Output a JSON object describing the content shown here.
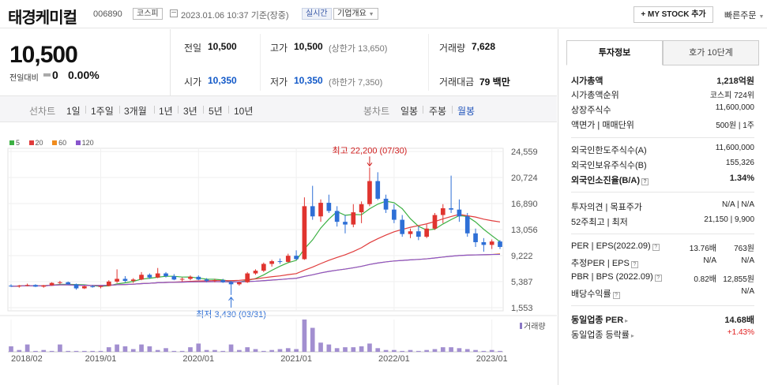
{
  "header": {
    "name": "태경케미컬",
    "code": "006890",
    "market": "코스피",
    "datetime": "2023.01.06 10:37 기준(장중)",
    "realtime": "실시간",
    "corp_info": "기업개요",
    "my_stock": "+ MY STOCK 추가",
    "quick_order": "빠른주문"
  },
  "price": {
    "current": "10,500",
    "change_label": "전일대비",
    "change_value": "0",
    "change_pct": "0.00%"
  },
  "stats": {
    "prev_close_label": "전일",
    "prev_close": "10,500",
    "high_label": "고가",
    "high": "10,500",
    "upper_limit": "(상한가 13,650)",
    "volume_label": "거래량",
    "volume": "7,628",
    "open_label": "시가",
    "open": "10,350",
    "low_label": "저가",
    "low": "10,350",
    "lower_limit": "(하한가 7,350)",
    "amount_label": "거래대금",
    "amount": "79 백만"
  },
  "period_bar": {
    "line_label": "선차트",
    "line_options": [
      "1일",
      "1주일",
      "3개월",
      "1년",
      "3년",
      "5년",
      "10년"
    ],
    "candle_label": "봉차트",
    "candle_options": [
      "일봉",
      "주봉",
      "월봉"
    ],
    "active_candle": "월봉"
  },
  "chart_data": {
    "type": "candlestick",
    "title": "",
    "period": "monthly",
    "moving_averages": [
      {
        "name": "5",
        "color": "#3cb043"
      },
      {
        "name": "20",
        "color": "#e03c3c"
      },
      {
        "name": "60",
        "color": "#f08c1e"
      },
      {
        "name": "120",
        "color": "#8855cc"
      }
    ],
    "y_ticks": [
      24559,
      20724,
      16890,
      13056,
      9222,
      5387,
      1553
    ],
    "y_tick_labels": [
      "24,559",
      "20,724",
      "16,890",
      "13,056",
      "9,222",
      "5,387",
      "1,553"
    ],
    "ylim": [
      1553,
      24559
    ],
    "x_tick_labels": [
      "2018/02",
      "2019/01",
      "2020/01",
      "2021/01",
      "2022/01",
      "2023/01"
    ],
    "high_annotation": "최고 22,200 (07/30)",
    "low_annotation": "최저 3,430 (03/31)",
    "volume_label": "거래량",
    "candles": [
      [
        4800,
        5000,
        4600,
        4700
      ],
      [
        4700,
        4900,
        4500,
        4800
      ],
      [
        4800,
        5100,
        4700,
        4900
      ],
      [
        4900,
        5000,
        4600,
        4650
      ],
      [
        4650,
        4900,
        4500,
        4850
      ],
      [
        4850,
        5300,
        4800,
        5200
      ],
      [
        5200,
        5500,
        5000,
        5300
      ],
      [
        5300,
        5400,
        4900,
        5000
      ],
      [
        5000,
        5100,
        4200,
        4400
      ],
      [
        4400,
        4800,
        4300,
        4700
      ],
      [
        4700,
        4900,
        4500,
        4600
      ],
      [
        4600,
        4800,
        4400,
        4750
      ],
      [
        4750,
        5600,
        4700,
        5400
      ],
      [
        5400,
        7200,
        5200,
        5800
      ],
      [
        5800,
        6200,
        5300,
        5500
      ],
      [
        5500,
        5900,
        5200,
        5700
      ],
      [
        5700,
        6800,
        5600,
        6400
      ],
      [
        6400,
        6600,
        5800,
        6000
      ],
      [
        6000,
        7400,
        5900,
        6600
      ],
      [
        6600,
        6800,
        6000,
        6200
      ],
      [
        6200,
        6500,
        5600,
        5700
      ],
      [
        5700,
        6000,
        5400,
        5800
      ],
      [
        5800,
        6300,
        5600,
        6100
      ],
      [
        6100,
        6300,
        5600,
        5700
      ],
      [
        5700,
        5900,
        5300,
        5500
      ],
      [
        5500,
        5800,
        5300,
        5600
      ],
      [
        5600,
        5800,
        5200,
        5300
      ],
      [
        5300,
        5500,
        3430,
        5000
      ],
      [
        5000,
        5400,
        4800,
        5300
      ],
      [
        5300,
        6800,
        5200,
        6600
      ],
      [
        6600,
        7200,
        6400,
        7000
      ],
      [
        7000,
        8200,
        6800,
        8000
      ],
      [
        8000,
        8600,
        7600,
        8400
      ],
      [
        8400,
        8800,
        8000,
        8300
      ],
      [
        8300,
        9500,
        8200,
        9200
      ],
      [
        9200,
        10000,
        8600,
        8700
      ],
      [
        8700,
        17800,
        8600,
        16500
      ],
      [
        16500,
        19500,
        14500,
        15000
      ],
      [
        15000,
        17500,
        14200,
        17000
      ],
      [
        17000,
        18200,
        15500,
        15800
      ],
      [
        15800,
        16500,
        13500,
        14200
      ],
      [
        14200,
        15200,
        12500,
        13800
      ],
      [
        13800,
        16800,
        13400,
        15600
      ],
      [
        15600,
        17200,
        14000,
        16800
      ],
      [
        16800,
        22200,
        16500,
        20200
      ],
      [
        20200,
        21500,
        17400,
        17600
      ],
      [
        17600,
        18200,
        15500,
        16000
      ],
      [
        16000,
        16800,
        14000,
        14500
      ],
      [
        14500,
        15200,
        12000,
        12400
      ],
      [
        12400,
        13200,
        11800,
        12800
      ],
      [
        12800,
        13500,
        11500,
        12000
      ],
      [
        12000,
        13800,
        11800,
        13200
      ],
      [
        13200,
        15500,
        13000,
        15200
      ],
      [
        15200,
        16800,
        14000,
        16200
      ],
      [
        16200,
        21000,
        15500,
        16000
      ],
      [
        16000,
        17500,
        14200,
        15000
      ],
      [
        15000,
        15500,
        12000,
        12500
      ],
      [
        12500,
        13200,
        10500,
        11200
      ],
      [
        11200,
        11800,
        9800,
        10800
      ],
      [
        10800,
        11600,
        10200,
        11300
      ],
      [
        11300,
        11500,
        10200,
        10500
      ]
    ],
    "volumes": [
      6,
      2,
      8,
      1,
      2,
      1,
      8,
      1,
      1,
      1,
      1,
      1,
      5,
      8,
      6,
      3,
      8,
      6,
      2,
      4,
      1,
      1,
      5,
      9,
      2,
      2,
      1,
      8,
      2,
      5,
      3,
      1,
      2,
      3,
      4,
      3,
      35,
      26,
      10,
      8,
      4,
      5,
      5,
      6,
      9,
      4,
      2,
      2,
      1,
      2,
      1,
      2,
      3,
      5,
      5,
      4,
      3,
      2,
      1,
      2,
      1
    ]
  },
  "right_panel": {
    "tab_invest": "투자정보",
    "tab_quote": "호가 10단계",
    "rows1": [
      {
        "k": "시가총액",
        "v": "1,218억원"
      },
      {
        "k": "시가총액순위",
        "v": "코스피 724위"
      },
      {
        "k": "상장주식수",
        "v": "11,600,000"
      },
      {
        "k": "액면가 | 매매단위",
        "v": "500원 | 1주"
      }
    ],
    "rows2": [
      {
        "k": "외국인한도주식수(A)",
        "v": "11,600,000"
      },
      {
        "k": "외국인보유주식수(B)",
        "v": "155,326"
      },
      {
        "k": "외국인소진율(B/A)",
        "v": "1.34%"
      }
    ],
    "rows3": [
      {
        "k": "투자의견 | 목표주가",
        "v": "N/A | N/A"
      },
      {
        "k": "52주최고 | 최저",
        "v": "21,150 | 9,900"
      }
    ],
    "per_label": "PER | EPS(2022.09)",
    "per_val": "13.76배",
    "eps_val": "763원",
    "eper_label": "추정PER | EPS",
    "eper_val": "N/A",
    "eeps_val": "N/A",
    "pbr_label": "PBR | BPS (2022.09)",
    "pbr_val": "0.82배",
    "bps_val": "12,855원",
    "div_label": "배당수익률",
    "div_val": "N/A",
    "sector_per_label": "동일업종 PER",
    "sector_per_val": "14.68배",
    "sector_rate_label": "동일업종 등락률",
    "sector_rate_val": "+1.43%"
  }
}
